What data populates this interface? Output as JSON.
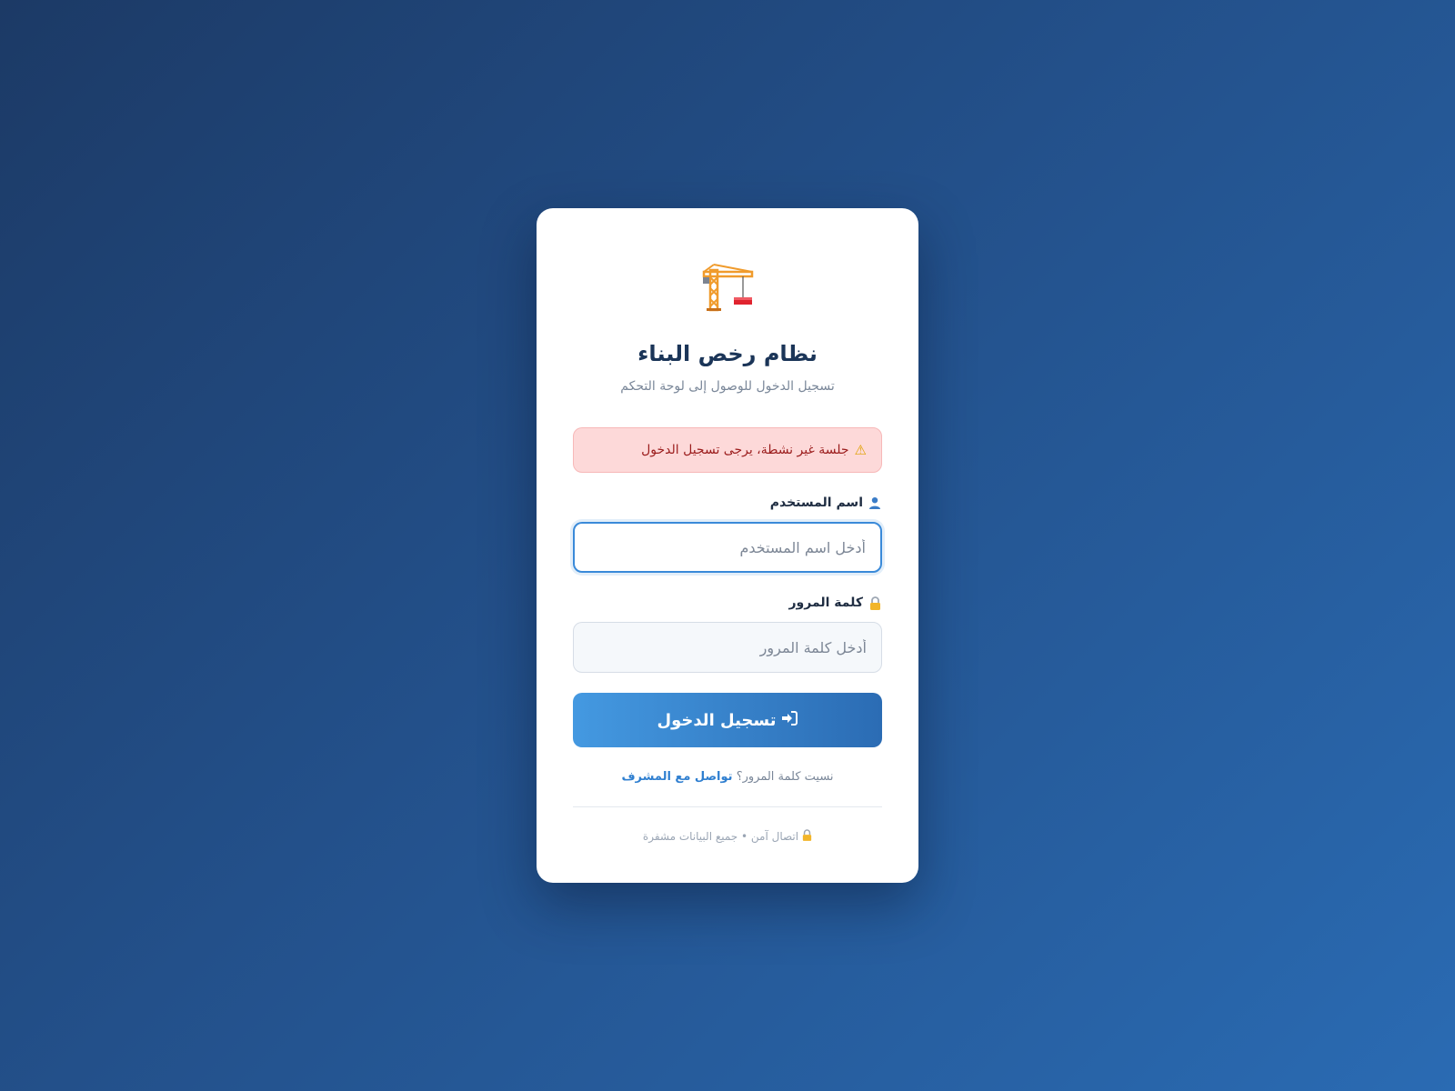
{
  "header": {
    "logo_icon": "crane-icon",
    "title": "نظام رخص البناء",
    "subtitle": "تسجيل الدخول للوصول إلى لوحة التحكم"
  },
  "alert": {
    "icon": "warning-icon",
    "message": "جلسة غير نشطة، يرجى تسجيل الدخول"
  },
  "form": {
    "username_label": "اسم المستخدم",
    "username_placeholder": "أدخل اسم المستخدم",
    "username_value": "",
    "password_label": "كلمة المرور",
    "password_placeholder": "أدخل كلمة المرور",
    "password_value": "",
    "submit_label": "تسجيل الدخول"
  },
  "footer": {
    "forgot_text": "نسيت كلمة المرور؟",
    "contact_link": "تواصل مع المشرف",
    "secure_text": "اتصال آمن • جميع البيانات مشفرة"
  },
  "colors": {
    "accent": "#2f7fd0",
    "title": "#1b3558",
    "alert_bg": "#fdd9d9",
    "alert_text": "#9b1c1c"
  }
}
